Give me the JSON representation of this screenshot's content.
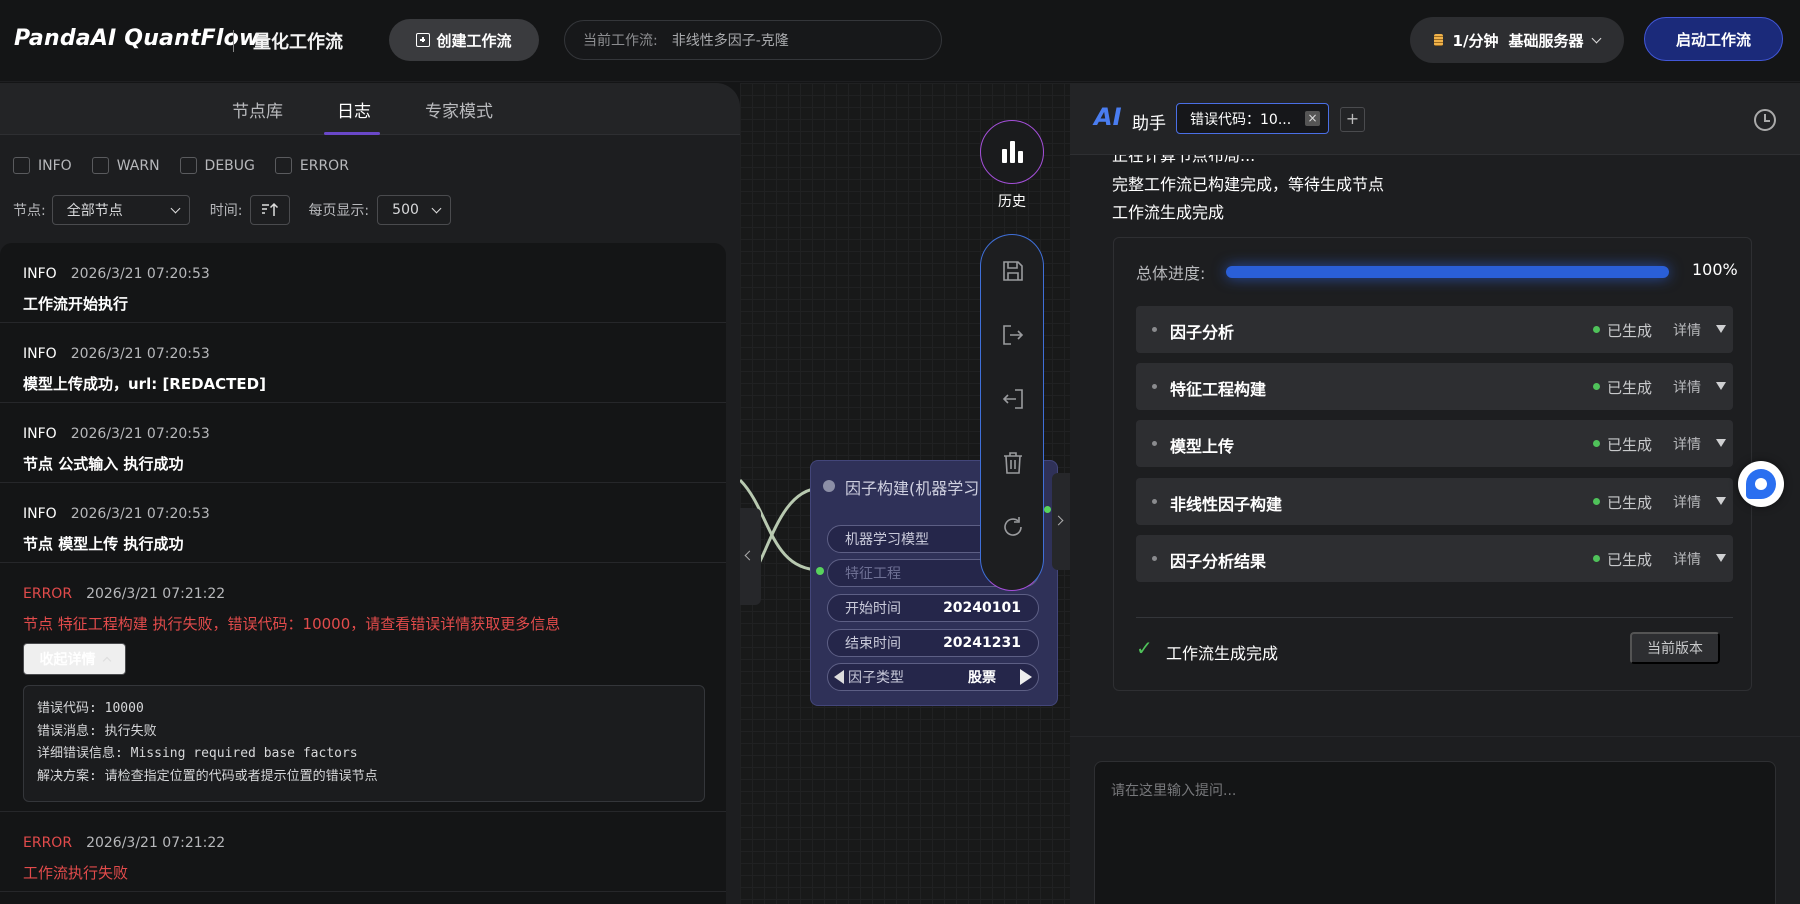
{
  "header": {
    "brand": "PandaAI QuantFlow",
    "subtitle": "量化工作流",
    "create_label": "创建工作流",
    "current_prefix": "当前工作流:",
    "current_value": "非线性多因子-克隆",
    "server_rate": "1/分钟",
    "server_name": "基础服务器",
    "start_label": "启动工作流"
  },
  "left": {
    "tabs": [
      {
        "label": "节点库"
      },
      {
        "label": "日志"
      },
      {
        "label": "专家模式"
      }
    ],
    "filters": {
      "levels": [
        "INFO",
        "WARN",
        "DEBUG",
        "ERROR"
      ],
      "node_label": "节点:",
      "node_value": "全部节点",
      "time_label": "时间:",
      "page_label": "每页显示:",
      "page_value": "500"
    },
    "logs": [
      {
        "level": "INFO",
        "time": "2026/3/21 07:20:53",
        "msg": "工作流开始执行"
      },
      {
        "level": "INFO",
        "time": "2026/3/21 07:20:53",
        "msg": "模型上传成功，url: [REDACTED]"
      },
      {
        "level": "INFO",
        "time": "2026/3/21 07:20:53",
        "msg": "节点 公式输入 执行成功"
      },
      {
        "level": "INFO",
        "time": "2026/3/21 07:20:53",
        "msg": "节点 模型上传 执行成功"
      },
      {
        "level": "ERROR",
        "time": "2026/3/21 07:21:22",
        "msg": "节点 特征工程构建 执行失败，错误代码：10000，请查看错误详情获取更多信息"
      },
      {
        "level": "ERROR",
        "time": "2026/3/21 07:21:22",
        "msg": "工作流执行失败"
      }
    ],
    "collapse_label": "收起详情",
    "error_detail": [
      "错误代码: 10000",
      "错误消息: 执行失败",
      "详细错误信息: Missing required base factors",
      "解决方案: 请检查指定位置的代码或者提示位置的错误节点"
    ]
  },
  "canvas": {
    "node_title": "因子构建(机器学习",
    "fields": [
      {
        "label": "机器学习模型",
        "value": ""
      },
      {
        "label": "特征工程",
        "value": ""
      },
      {
        "label": "开始时间",
        "value": "20240101"
      },
      {
        "label": "结束时间",
        "value": "20241231"
      },
      {
        "label": "因子类型",
        "value": "股票"
      }
    ],
    "history_label": "历史"
  },
  "assistant": {
    "logo": "AI",
    "label": "助手",
    "tab_label": "错误代码：10...",
    "tab_close": "×",
    "add_tab": "+",
    "lines": [
      "正在计算节点布局...",
      "完整工作流已构建完成，等待生成节点",
      "工作流生成完成"
    ],
    "progress_label": "总体进度:",
    "progress_value": 100,
    "progress_text": "100%",
    "steps": [
      {
        "name": "因子分析",
        "status": "已生成",
        "detail": "详情"
      },
      {
        "name": "特征工程构建",
        "status": "已生成",
        "detail": "详情"
      },
      {
        "name": "模型上传",
        "status": "已生成",
        "detail": "详情"
      },
      {
        "name": "非线性因子构建",
        "status": "已生成",
        "detail": "详情"
      },
      {
        "name": "因子分析结果",
        "status": "已生成",
        "detail": "详情"
      }
    ],
    "done_mark": "✓",
    "done_text": "工作流生成完成",
    "version_label": "当前版本",
    "input_placeholder": "请在这里输入提问..."
  },
  "colors": {
    "accent": "#2a5fd8",
    "error": "#e24b4b",
    "success": "#4fc25a",
    "node_bg": "#2f3158"
  }
}
